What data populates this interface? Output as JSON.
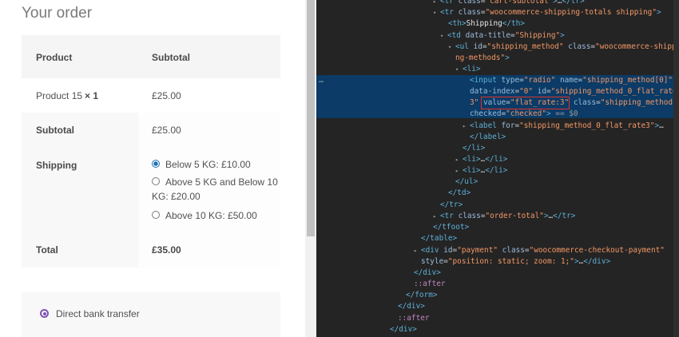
{
  "order": {
    "heading": "Your order",
    "columns": {
      "product": "Product",
      "subtotal": "Subtotal"
    },
    "item": {
      "name": "Product 15",
      "qty": "× 1",
      "price": "£25.00"
    },
    "subtotal": {
      "label": "Subtotal",
      "value": "£25.00"
    },
    "shipping": {
      "label": "Shipping",
      "options": [
        {
          "text": "Below 5 KG: £10.00",
          "checked": true
        },
        {
          "line1": "Above 5 KG and Below 10",
          "line2": "KG: £20.00",
          "checked": false
        },
        {
          "text": "Above 10 KG: £50.00",
          "checked": false
        }
      ]
    },
    "total": {
      "label": "Total",
      "value": "£35.00"
    }
  },
  "payment": {
    "method": "Direct bank transfer"
  },
  "devtools": {
    "colors": {
      "background": "#242424",
      "selection": "#0b3b66",
      "highlight": "#e0332d"
    },
    "lines": [
      {
        "indent": "        ",
        "arrow": "▸",
        "html": "<span class='tag'>&lt;tr</span> <span class='attr'>class</span>=<span class='val'>\"cart-subtotal\"</span><span class='tag'>&gt;</span>…<span class='tag'>&lt;/tr&gt;</span>"
      },
      {
        "indent": "        ",
        "arrow": "▾",
        "html": "<span class='tag'>&lt;tr</span> <span class='attr'>class</span>=<span class='val'>\"woocommerce-shipping-totals shipping\"</span><span class='tag'>&gt;</span>"
      }
    ]
  }
}
